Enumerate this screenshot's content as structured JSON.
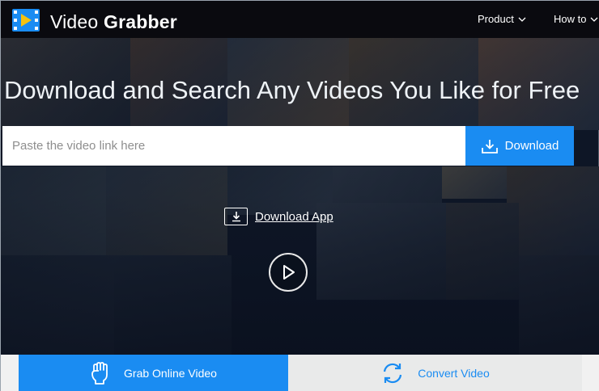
{
  "header": {
    "brand_light": "Video ",
    "brand_bold": "Grabber",
    "nav": [
      {
        "label": "Product"
      },
      {
        "label": "How to"
      }
    ]
  },
  "hero": {
    "title": "Download and Search Any Videos You Like for Free",
    "search_placeholder": "Paste the video link here",
    "download_label": "Download",
    "download_app_label": "Download App"
  },
  "tabs": [
    {
      "label": "Grab Online Video",
      "icon": "fist-icon",
      "active": true
    },
    {
      "label": "Convert Video",
      "icon": "convert-arrows-icon",
      "active": false
    }
  ],
  "colors": {
    "accent": "#1a8cf2",
    "header_bg": "#0a0a0f",
    "background": "#0e1626"
  }
}
